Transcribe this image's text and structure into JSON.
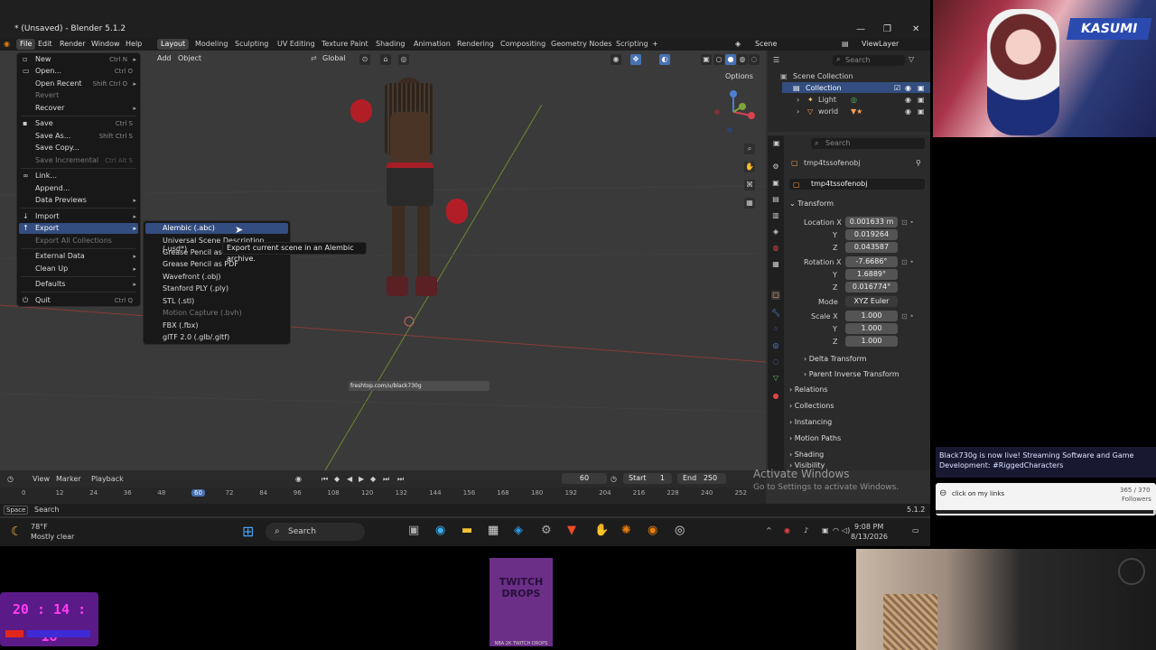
{
  "window": {
    "title": "* (Unsaved) - Blender 5.1.2",
    "controls": {
      "minimize": "—",
      "maximize": "❐",
      "close": "✕"
    }
  },
  "menubar": {
    "items": [
      "File",
      "Edit",
      "Render",
      "Window",
      "Help"
    ],
    "workspaces": [
      "Layout",
      "Modeling",
      "Sculpting",
      "UV Editing",
      "Texture Paint",
      "Shading",
      "Animation",
      "Rendering",
      "Compositing",
      "Geometry Nodes",
      "Scripting"
    ],
    "active_workspace": "Layout",
    "scene_label": "Scene",
    "view_layer_label": "ViewLayer"
  },
  "viewport": {
    "header": {
      "add": "Add",
      "object": "Object",
      "orientation": "Global",
      "options": "Options"
    },
    "overlay_text": "freshtop.com/u/black730g"
  },
  "file_menu": {
    "items": [
      {
        "label": "New",
        "shortcut": "Ctrl N",
        "submenu": true
      },
      {
        "label": "Open...",
        "shortcut": "Ctrl O"
      },
      {
        "label": "Open Recent",
        "shortcut": "Shift Ctrl O",
        "submenu": true
      },
      {
        "label": "Revert",
        "disabled": true
      },
      {
        "label": "Recover",
        "submenu": true
      },
      {
        "label": "Save",
        "shortcut": "Ctrl S"
      },
      {
        "label": "Save As...",
        "shortcut": "Shift Ctrl S"
      },
      {
        "label": "Save Copy..."
      },
      {
        "label": "Save Incremental",
        "shortcut": "Ctrl Alt S",
        "disabled": true
      },
      {
        "label": "Link..."
      },
      {
        "label": "Append..."
      },
      {
        "label": "Data Previews",
        "submenu": true
      },
      {
        "label": "Import",
        "submenu": true
      },
      {
        "label": "Export",
        "submenu": true,
        "active": true
      },
      {
        "label": "Export All Collections",
        "disabled": true
      },
      {
        "label": "External Data",
        "submenu": true
      },
      {
        "label": "Clean Up",
        "submenu": true
      },
      {
        "label": "Defaults",
        "submenu": true
      },
      {
        "label": "Quit",
        "shortcut": "Ctrl Q"
      }
    ]
  },
  "export_menu": {
    "items": [
      {
        "label": "Alembic (.abc)",
        "active": true
      },
      {
        "label": "Universal Scene Description (.usd*)"
      },
      {
        "label": "Grease Pencil as SVG"
      },
      {
        "label": "Grease Pencil as PDF"
      },
      {
        "label": "Wavefront (.obj)"
      },
      {
        "label": "Stanford PLY (.ply)"
      },
      {
        "label": "STL (.stl)"
      },
      {
        "label": "Motion Capture (.bvh)",
        "disabled": true
      },
      {
        "label": "FBX (.fbx)"
      },
      {
        "label": "glTF 2.0 (.glb/.gltf)"
      }
    ],
    "tooltip": "Export current scene in an Alembic archive."
  },
  "outliner": {
    "search_placeholder": "Search",
    "scene_collection": "Scene Collection",
    "collection": "Collection",
    "items": [
      "Light",
      "world"
    ]
  },
  "properties": {
    "search_placeholder": "Search",
    "object_name": "tmp4tssofenobj",
    "datablock_name": "tmp4tssofenobj",
    "transform_label": "Transform",
    "location": {
      "label": "Location X",
      "x": "0.001633 m",
      "y": "0.019264",
      "z": "0.043587"
    },
    "rotation": {
      "label": "Rotation X",
      "x": "-7.6686°",
      "y": "1.6889°",
      "z": "0.016774°"
    },
    "mode": {
      "label": "Mode",
      "value": "XYZ Euler"
    },
    "scale": {
      "label": "Scale X",
      "x": "1.000",
      "y": "1.000",
      "z": "1.000"
    },
    "axis_y": "Y",
    "axis_z": "Z",
    "subsections": [
      "Delta Transform",
      "Parent Inverse Transform"
    ],
    "sections": [
      "Relations",
      "Collections",
      "Instancing",
      "Motion Paths",
      "Shading",
      "Visibility",
      "Viewport Display",
      "Line Art"
    ]
  },
  "timeline": {
    "view": "View",
    "marker": "Marker",
    "playback": "Playback",
    "current_frame": "60",
    "start_label": "Start",
    "start": "1",
    "end_label": "End",
    "end": "250",
    "ruler": [
      "0",
      "12",
      "24",
      "36",
      "48",
      "60",
      "72",
      "84",
      "96",
      "108",
      "120",
      "132",
      "144",
      "156",
      "168",
      "180",
      "192",
      "204",
      "216",
      "228",
      "240",
      "252"
    ]
  },
  "statusbar": {
    "key": "Space",
    "action": "Search",
    "version": "5.1.2"
  },
  "taskbar": {
    "weather_temp": "78°F",
    "weather_desc": "Mostly clear",
    "search": "Search",
    "time": "9:08 PM",
    "date": "8/13/2026"
  },
  "watermark": {
    "line1": "Activate Windows",
    "line2": "Go to Settings to activate Windows."
  },
  "stream": {
    "chat_message": "Black730g is now live! Streaming Software and Game Development: #RiggedCharacters",
    "links_text": "click on my links",
    "followers_count": "365 / 370",
    "followers_label": "Followers",
    "clock": "20 : 14 : 18",
    "drops_line1": "TWITCH",
    "drops_line2": "DROPS",
    "drops_caption": "NBA 2K TWITCH DROPS"
  },
  "colors": {
    "accent": "#4772b3",
    "menu_bg": "#181818",
    "viewport_bg": "#3a3a3a"
  }
}
